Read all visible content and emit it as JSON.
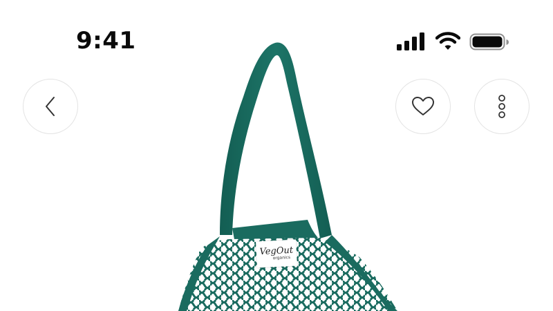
{
  "status_bar": {
    "time": "9:41",
    "icons": [
      "signal-icon",
      "wifi-icon",
      "battery-icon"
    ]
  },
  "nav": {
    "back_icon": "chevron-left-icon",
    "favorite_icon": "heart-icon",
    "more_icon": "more-vertical-icon"
  },
  "product": {
    "image": "green-mesh-tote-bag",
    "tag_brand": "VegOut",
    "tag_sub": "organics",
    "color": "#1a6b5f"
  }
}
